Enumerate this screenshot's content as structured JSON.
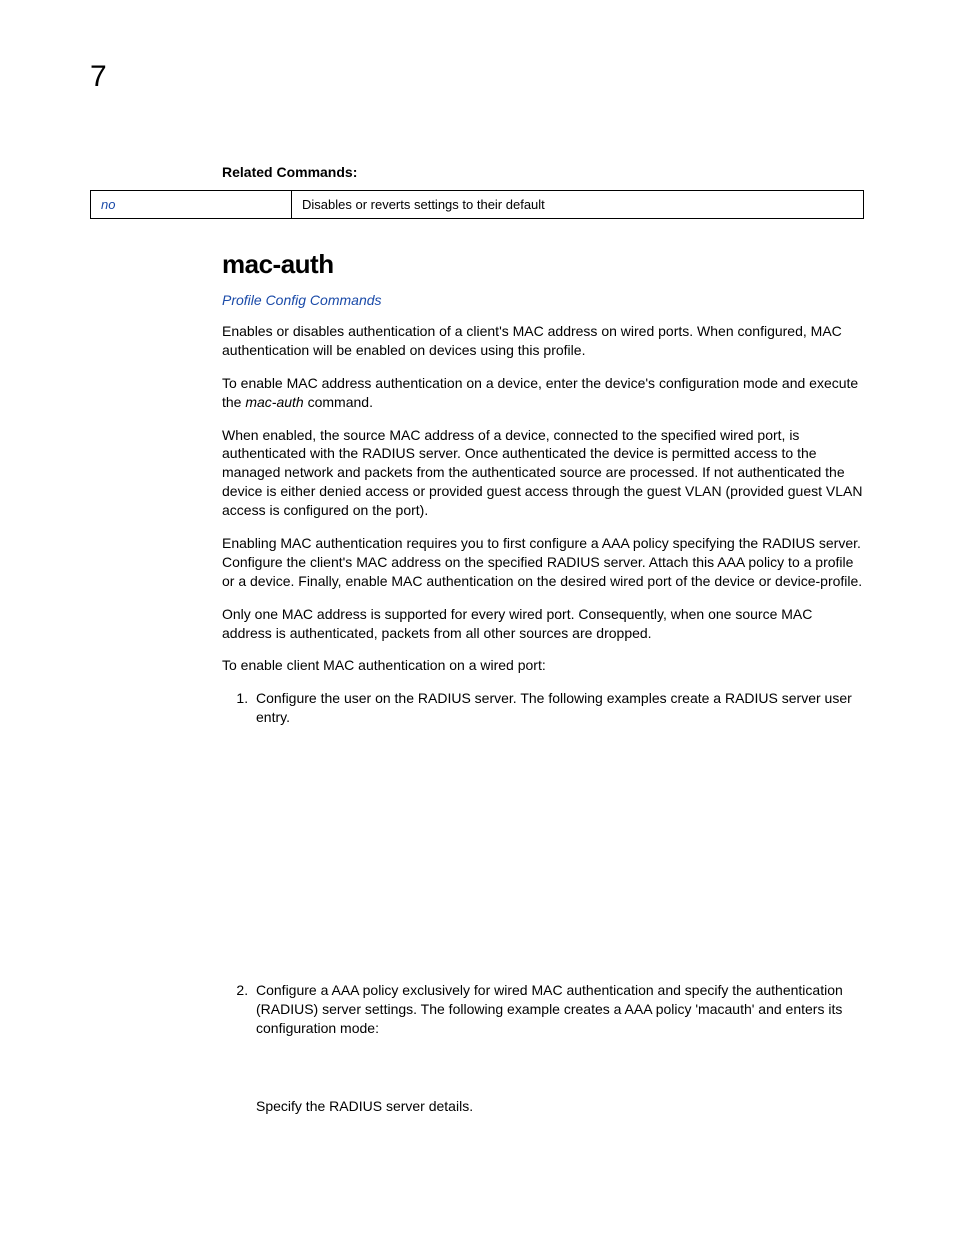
{
  "page_number": "7",
  "related_commands": {
    "heading": "Related Commands:",
    "rows": [
      {
        "cmd": "no",
        "desc": "Disables or reverts settings to their default"
      }
    ]
  },
  "section": {
    "title": "mac-auth",
    "link": "Profile Config Commands",
    "p1": "Enables or disables authentication of a client's MAC address on wired ports. When configured, MAC authentication will be enabled on devices using this profile.",
    "p2a": "To enable MAC address authentication on a device, enter the device's configuration mode and execute the ",
    "p2b": "mac-auth",
    "p2c": " command.",
    "p3": "When enabled, the source MAC address of a device, connected to the specified wired port, is authenticated with the RADIUS server. Once authenticated the device is permitted access to the managed network and packets from the authenticated source are processed. If not authenticated the device is either denied access or provided guest access through the guest VLAN (provided guest VLAN access is configured on the port).",
    "p4": "Enabling MAC authentication requires you to first configure a AAA policy specifying the RADIUS server. Configure the client's MAC address on the specified RADIUS server. Attach this AAA policy to a profile or a device. Finally, enable MAC authentication on the desired wired port of the device or device-profile.",
    "p5": "Only one MAC address is supported for every wired port. Consequently, when one source MAC address is authenticated, packets from all other sources are dropped.",
    "p6": "To enable client MAC authentication on a wired port:",
    "steps": {
      "s1": "Configure the user on the RADIUS server. The following examples create a RADIUS server user entry.",
      "s2": "Configure a AAA policy exclusively for wired MAC authentication and specify the authentication (RADIUS) server settings. The following example creates a AAA policy 'macauth' and enters its configuration mode:",
      "s2_sub": "Specify the RADIUS server details."
    }
  }
}
